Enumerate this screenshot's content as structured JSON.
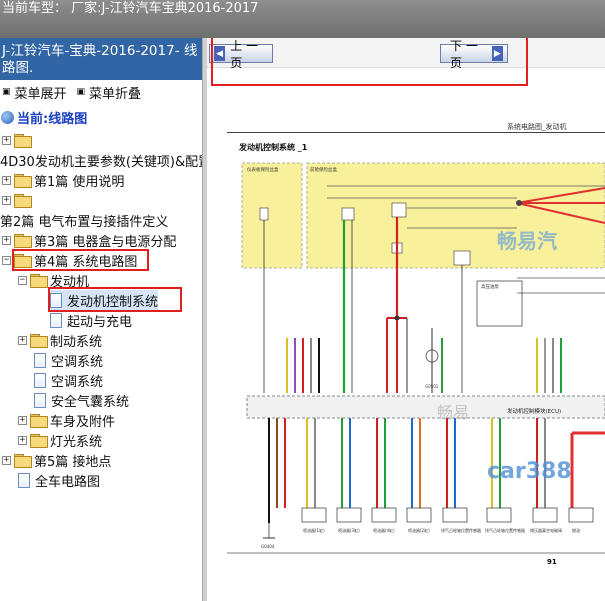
{
  "header": {
    "vehicle_label": "当前车型：  厂家:J-江铃汽车宝典2016-2017"
  },
  "sidebar": {
    "title": "J-江铃汽车-宝典-2016-2017- 线路图.",
    "expand_label": "菜单展开",
    "collapse_label": "菜单折叠",
    "current_label": "当前:线路图",
    "tree": [
      {
        "label": ""
      },
      {
        "label": "4D30发动机主要参数(关键项)&配置"
      },
      {
        "label": "第1篇 使用说明"
      },
      {
        "label": ""
      },
      {
        "label": "第2篇 电气布置与接插件定义"
      },
      {
        "label": "第3篇 电器盒与电源分配"
      },
      {
        "label": "第4篇 系统电路图"
      },
      {
        "label": "发动机"
      },
      {
        "label": "发动机控制系统"
      },
      {
        "label": "起动与充电"
      },
      {
        "label": "制动系统"
      },
      {
        "label": "空调系统"
      },
      {
        "label": "空调系统"
      },
      {
        "label": "安全气囊系统"
      },
      {
        "label": "车身及附件"
      },
      {
        "label": "灯光系统"
      },
      {
        "label": "第5篇 接地点"
      },
      {
        "label": "全车电路图"
      }
    ]
  },
  "nav": {
    "prev_label": "上 一 页",
    "next_label": "下 一 页",
    "next_arrow": "▶"
  },
  "diagram": {
    "page_header": "系统电路图_发动机",
    "title": "发动机控制系统 _1",
    "ecu_label": "发动机控制模块(ECU)",
    "page_number": "91",
    "watermark": "畅易汽",
    "watermark2": "car388",
    "watermark3": "畅易",
    "box1": "仪表板保险丝盒",
    "box2": "前舱保险丝盒",
    "box3": "高压油泵",
    "ground": "G0404",
    "ground2": "G0501",
    "bottom_labels": [
      "喷油器(1缸)",
      "喷油器(3缸)",
      "喷油器(4缸)",
      "喷油器(2缸)",
      "排气凸轮轴位置传感器",
      "排气凸轮轴位置传感器",
      "增压器真空电磁阀",
      "燃油"
    ]
  },
  "colors": {
    "accent": "#3165a4",
    "highlight": "#e02020",
    "fuse_box": "#f8f09a"
  }
}
